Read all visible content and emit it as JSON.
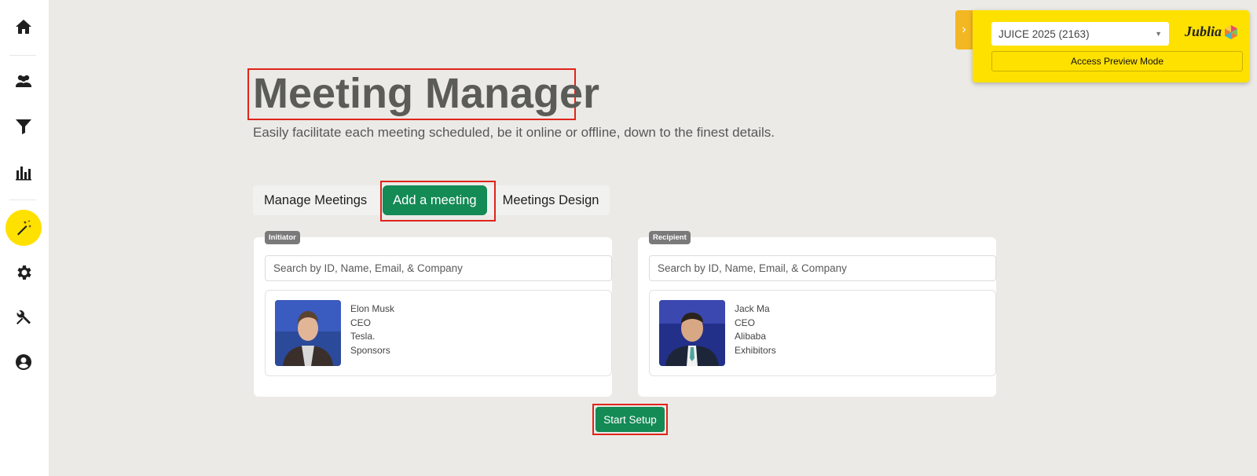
{
  "sidebar": {
    "items": [
      {
        "icon": "home-icon"
      },
      {
        "icon": "users-icon"
      },
      {
        "icon": "filter-icon"
      },
      {
        "icon": "chart-icon"
      },
      {
        "icon": "magic-wand-icon",
        "active": true
      },
      {
        "icon": "gear-icon"
      },
      {
        "icon": "tools-icon"
      },
      {
        "icon": "account-icon"
      }
    ]
  },
  "header": {
    "title": "Meeting Manager",
    "subtitle": "Easily facilitate each meeting scheduled, be it online or offline, down to the finest details."
  },
  "tabs": [
    {
      "label": "Manage Meetings"
    },
    {
      "label": "Add a meeting",
      "active": true
    },
    {
      "label": "Meetings Design"
    }
  ],
  "initiator": {
    "badge": "Initiator",
    "search_placeholder": "Search by ID, Name, Email, & Company",
    "name": "Elon Musk",
    "role": "CEO",
    "company": "Tesla.",
    "category": "Sponsors"
  },
  "recipient": {
    "badge": "Recipient",
    "search_placeholder": "Search by ID, Name, Email, & Company",
    "name": "Jack Ma",
    "role": "CEO",
    "company": "Alibaba",
    "category": "Exhibitors"
  },
  "start_button": "Start Setup",
  "top_panel": {
    "event_select": "JUICE 2025 (2163)",
    "logo_text": "Jublia",
    "preview_button": "Access Preview Mode"
  },
  "colors": {
    "accent_green": "#148a55",
    "highlight_yellow": "#ffe100",
    "annotation_red": "#e0241b"
  }
}
